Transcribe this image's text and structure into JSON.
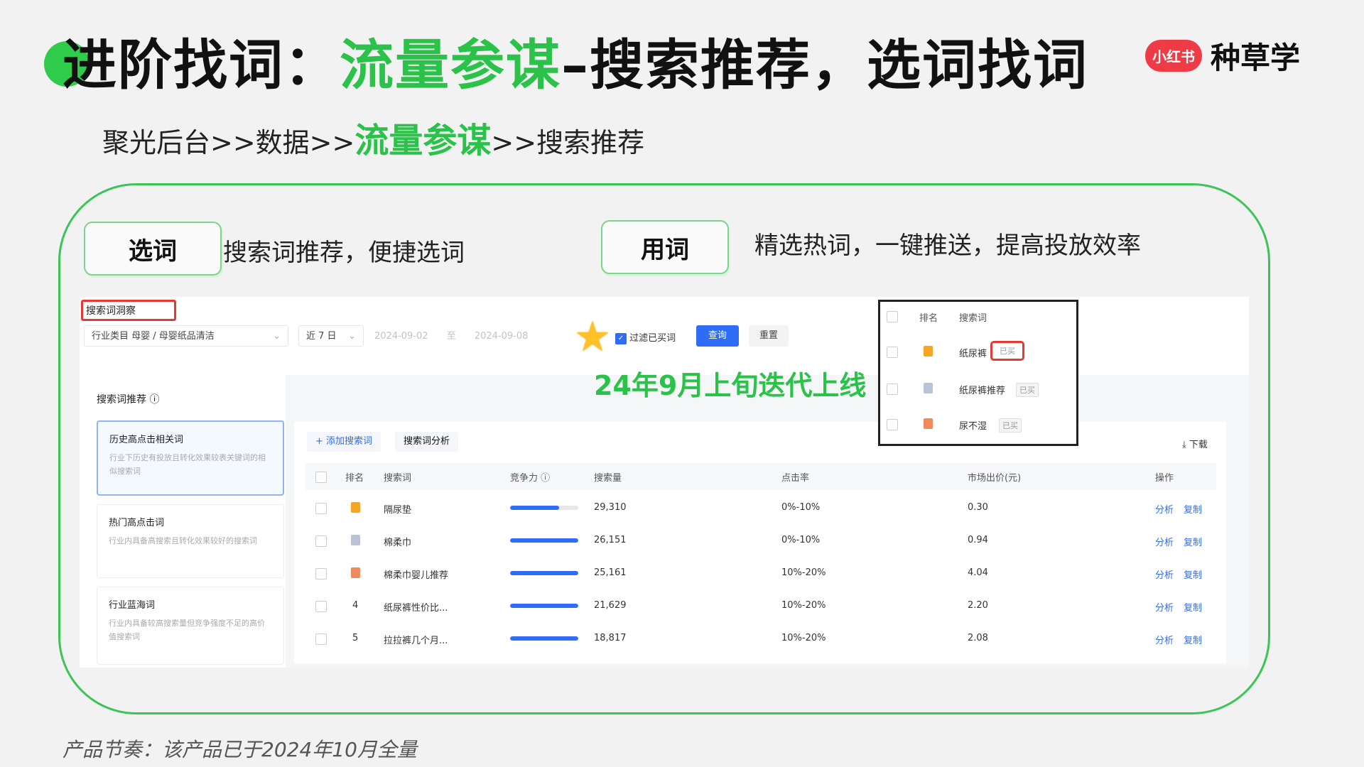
{
  "slide": {
    "title_prefix": "进阶找词：",
    "title_highlight": "流量参谋",
    "title_suffix": "–搜索推荐，选词找词",
    "brand_badge": "小红书",
    "brand_text": "种草学",
    "breadcrumb_prefix": "聚光后台>>数据>>",
    "breadcrumb_highlight": "流量参谋",
    "breadcrumb_suffix": ">>搜索推荐",
    "panel_tag": "「 搜索推荐 」–搜索词洞察",
    "pill_select": "选词",
    "pill_select_desc": "搜索词推荐，便捷选词",
    "pill_use": "用词",
    "pill_use_desc": "精选热词，一键推送，提高投放效率",
    "release_note": "24年9月上旬迭代上线",
    "footer": "产品节奏：该产品已于2024年10月全量"
  },
  "tool": {
    "page_title": "搜索词洞察",
    "industry_field": "行业类目   母婴 / 母婴纸品清洁",
    "range_field": "近 7 日",
    "date_start": "2024-09-02",
    "date_sep": "至",
    "date_end": "2024-09-08",
    "filter_label": "过滤已买词",
    "query_button": "查询",
    "reset_button": "重置",
    "section_title": "搜索词推荐 ⓘ",
    "cards": [
      {
        "title": "历史高点击相关词",
        "desc": "行业下历史有投放且转化效果较表关键词的相似搜索词"
      },
      {
        "title": "热门高点击词",
        "desc": "行业内具备高搜索且转化效果较好的搜索词"
      },
      {
        "title": "行业蓝海词",
        "desc": "行业内具备较高搜索量但竞争强度不足的高价值搜索词"
      }
    ],
    "add_button": "+ 添加搜索词",
    "analysis_button": "搜索词分析",
    "download_button": "⤓ 下载",
    "headers": [
      "排名",
      "搜索词",
      "竞争力 ⓘ",
      "搜索量",
      "点击率",
      "市场出价(元)",
      "操作"
    ],
    "rows": [
      {
        "rank": "",
        "rank_color": "#f5a623",
        "word": "隔尿垫",
        "competition": 0.72,
        "volume": "29,310",
        "ctr": "0%-10%",
        "bid": "0.30"
      },
      {
        "rank": "",
        "rank_color": "#b9c3d3",
        "word": "棉柔巾",
        "competition": 1.0,
        "volume": "26,151",
        "ctr": "0%-10%",
        "bid": "0.94"
      },
      {
        "rank": "",
        "rank_color": "#f08a5d",
        "word": "棉柔巾婴儿推荐",
        "competition": 1.0,
        "volume": "25,161",
        "ctr": "10%-20%",
        "bid": "4.04"
      },
      {
        "rank": "4",
        "rank_color": "",
        "word": "纸尿裤性价比...",
        "competition": 1.0,
        "volume": "21,629",
        "ctr": "10%-20%",
        "bid": "2.20"
      },
      {
        "rank": "5",
        "rank_color": "",
        "word": "拉拉裤几个月...",
        "competition": 1.0,
        "volume": "18,817",
        "ctr": "10%-20%",
        "bid": "2.08"
      }
    ],
    "op_analyze": "分析",
    "op_copy": "复制"
  },
  "callout": {
    "header_rank": "排名",
    "header_word": "搜索词",
    "rows": [
      {
        "word": "纸尿裤",
        "tag": "已买",
        "color": "#f5a623"
      },
      {
        "word": "纸尿裤推荐",
        "tag": "已买",
        "color": "#b9c3d3"
      },
      {
        "word": "尿不湿",
        "tag": "已买",
        "color": "#f08a5d"
      }
    ]
  }
}
